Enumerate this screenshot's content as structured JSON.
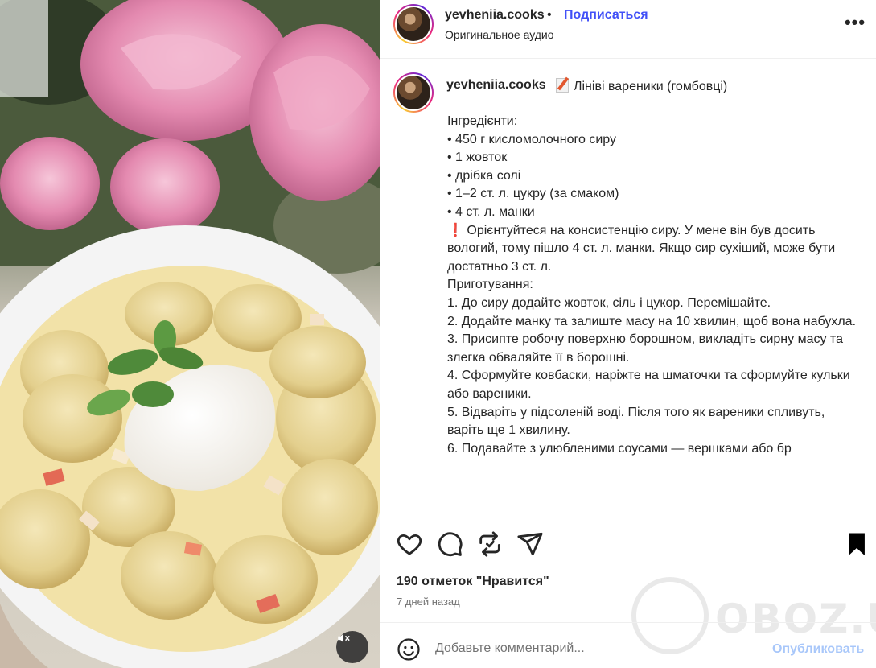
{
  "post": {
    "username": "yevheniia.cooks",
    "separator": "•",
    "follow_label": "Подписаться",
    "audio_label": "Оригинальное аудио",
    "more_label": "•••"
  },
  "caption": {
    "username": "yevheniia.cooks",
    "title_icon": "memo-icon",
    "title": "Лініві вареники (гомбовці)",
    "lines": [
      "Інгредієнти:",
      "• 450 г кисломолочного сиру",
      "• 1 жовток",
      "• дрібка солі",
      "• 1–2 ст. л. цукру (за смаком)",
      "• 4 ст. л. манки",
      "",
      "Орієнтуйтеся на консистенцію сиру. У мене він був досить вологий, тому пішло 4 ст. л. манки. Якщо сир сухіший, може бути достатньо 3 ст. л.",
      "",
      "Приготування:",
      "",
      "1. До сиру додайте жовток, сіль і цукор. Перемішайте.",
      "2. Додайте манку та залиште масу на 10 хвилин, щоб вона набухла.",
      "3. Присипте робочу поверхню борошном, викладіть сирну масу та злегка обваляйте її в борошні.",
      "4. Сформуйте ковбаски, наріжте на шматочки та сформуйте кульки або вареники.",
      "5. Відваріть у підсоленій воді. Після того як вареники спливуть, варіть ще 1 хвилину.",
      "6. Подавайте з улюбленими соусами — вершками або бр"
    ],
    "exclamation": "❗"
  },
  "actions": {
    "icons": [
      "heart-icon",
      "comment-icon",
      "repost-icon",
      "share-icon",
      "bookmark-icon"
    ],
    "likes": "190 отметок \"Нравится\"",
    "date": "7 дней назад"
  },
  "comment": {
    "placeholder": "Добавьте комментарий...",
    "publish_label": "Опубликовать"
  },
  "media": {
    "mute_icon": "speaker-muted-icon"
  },
  "watermark": {
    "text": "OBOZ.UA"
  },
  "colors": {
    "link_blue": "#4150f7",
    "publish_disabled": "#a8c7fa",
    "meta_gray": "#737373"
  }
}
